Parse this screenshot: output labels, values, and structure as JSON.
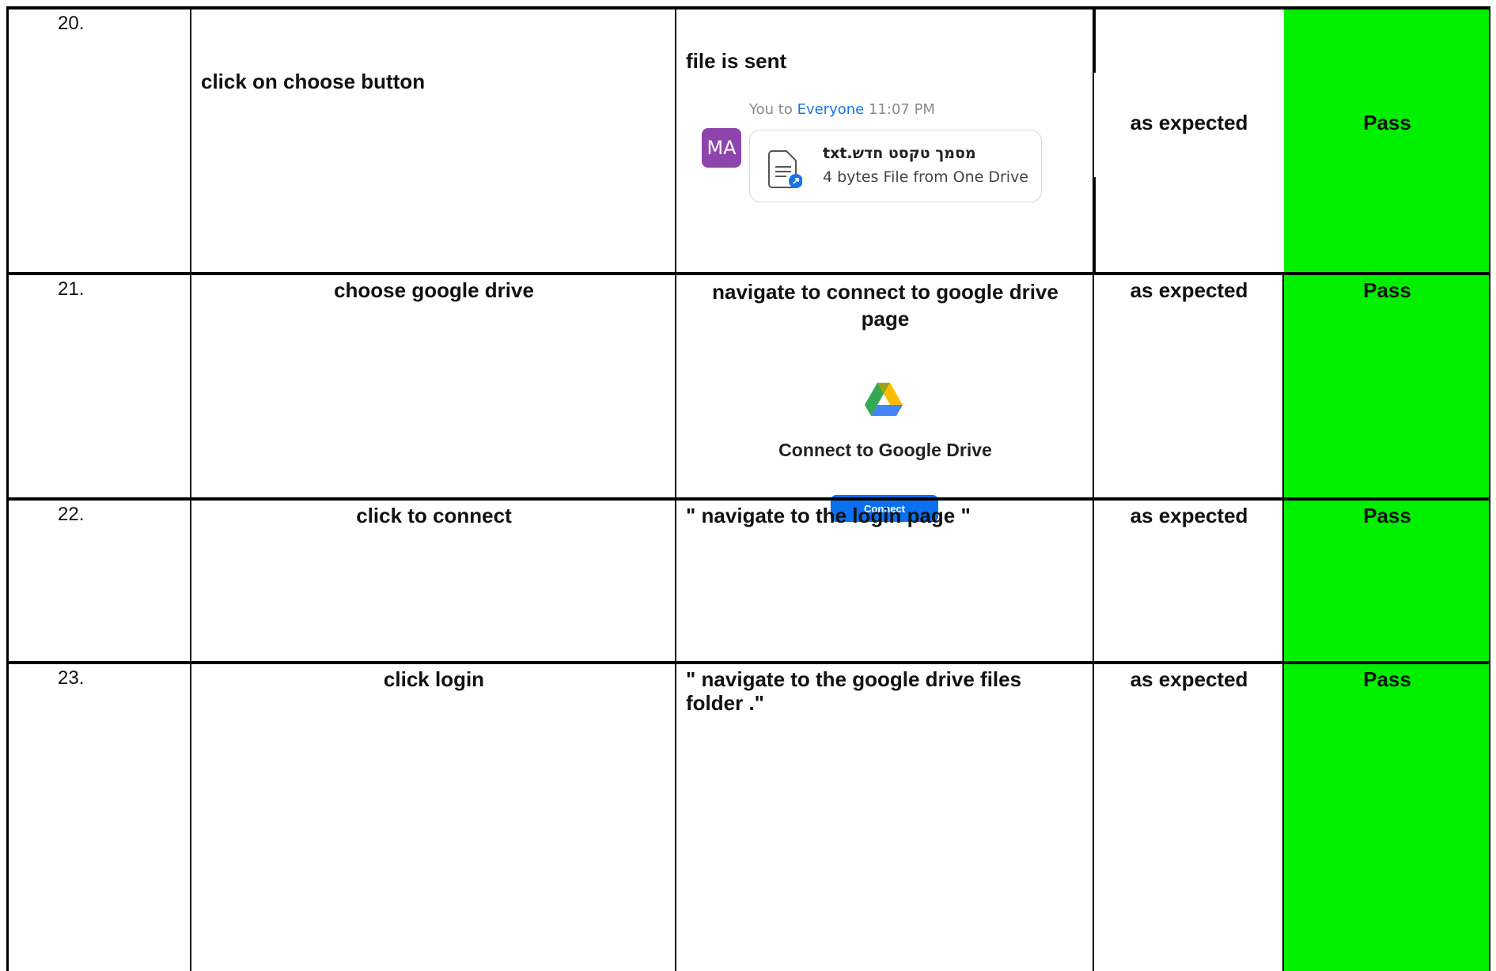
{
  "rows": [
    {
      "num": "20.",
      "step": "click on choose button",
      "expected": "file is sent",
      "actual": "as expected",
      "result": "Pass",
      "chat": {
        "sender": "You",
        "to_word": "to",
        "recipient": "Everyone",
        "time": "11:07 PM",
        "avatar": "MA",
        "file_name": "מסמך טקסט חדש.txt",
        "file_size": "4 bytes",
        "file_source": "File from One Drive",
        "icon": "document-icon"
      }
    },
    {
      "num": "21.",
      "step": "choose google drive",
      "expected": "navigate to connect  to google drive page",
      "actual": "as expected",
      "result": "Pass",
      "gdrive": {
        "title": "Connect to Google Drive",
        "button": "Connect",
        "icon": "google-drive-logo"
      }
    },
    {
      "num": "22.",
      "step": "click to connect",
      "expected": "\" navigate to the login page \"",
      "actual": "as expected",
      "result": "Pass"
    },
    {
      "num": "23.",
      "step": "click login",
      "expected": "\" navigate to the google drive files folder .\"",
      "actual": "as expected",
      "result": "Pass"
    }
  ],
  "colors": {
    "pass_bg": "#00f000",
    "link": "#1a73e8",
    "avatar": "#8e44ad",
    "connect_button": "#0b6ff0"
  }
}
